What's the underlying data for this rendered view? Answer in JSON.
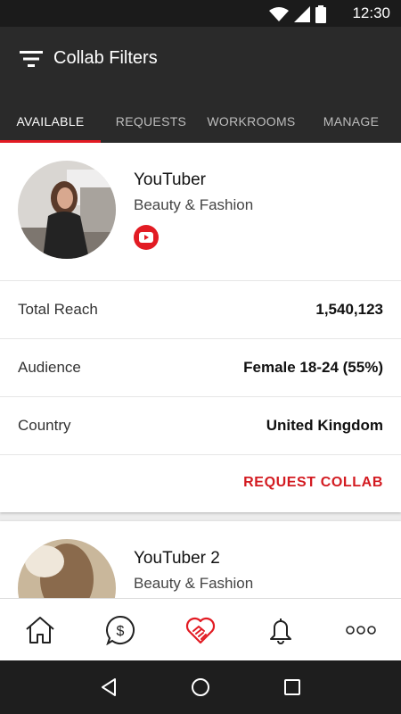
{
  "status_bar": {
    "time": "12:30"
  },
  "app_bar": {
    "title": "Collab Filters"
  },
  "tabs": [
    {
      "label": "AVAILABLE",
      "active": true
    },
    {
      "label": "REQUESTS",
      "active": false
    },
    {
      "label": "WORKROOMS",
      "active": false
    },
    {
      "label": "MANAGE",
      "active": false
    }
  ],
  "cards": [
    {
      "name": "YouTuber",
      "category": "Beauty & Fashion",
      "platform_icon": "youtube-icon",
      "rows": [
        {
          "label": "Total Reach",
          "value": "1,540,123"
        },
        {
          "label": "Audience",
          "value": "Female 18-24 (55%)"
        },
        {
          "label": "Country",
          "value": "United Kingdom"
        }
      ],
      "cta": "REQUEST COLLAB"
    },
    {
      "name": "YouTuber 2",
      "category": "Beauty & Fashion"
    }
  ],
  "bottom_nav": [
    {
      "icon": "home-icon"
    },
    {
      "icon": "dollar-icon"
    },
    {
      "icon": "handshake-heart-icon",
      "active": true
    },
    {
      "icon": "bell-icon"
    },
    {
      "icon": "more-icon"
    }
  ],
  "colors": {
    "accent": "#e21b23",
    "app_bar": "#2a2a2a",
    "status_bar": "#1b1b1b"
  }
}
